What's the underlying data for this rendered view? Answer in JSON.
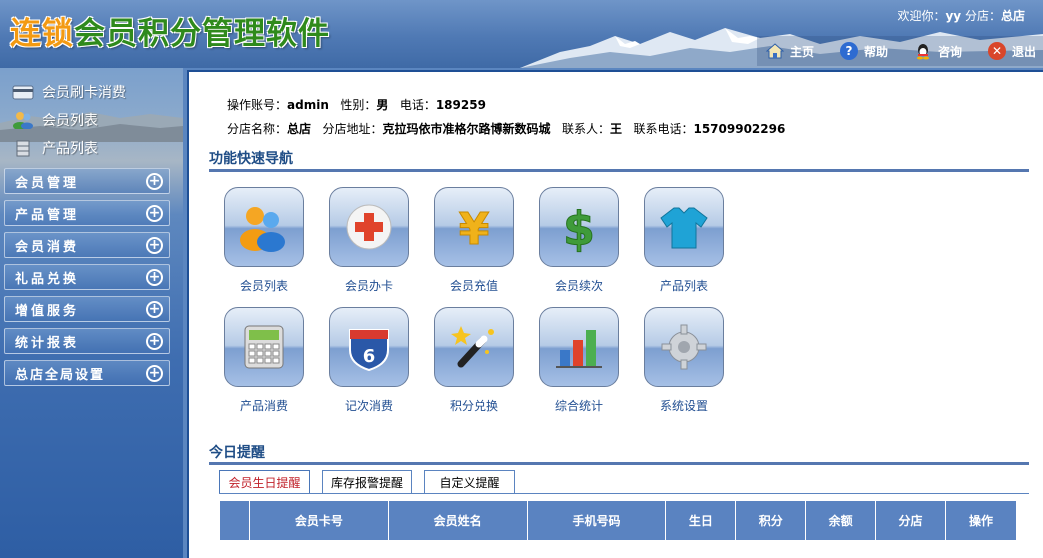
{
  "header": {
    "logo_part1": "连锁",
    "logo_part2": "会员积分管理软件",
    "welcome_prefix": "欢迎你：",
    "welcome_user": "yy",
    "branch_prefix": "分店：",
    "branch_name": "总店"
  },
  "topnav": [
    {
      "label": "主页",
      "icon": "home-icon",
      "color": "#3a6fc2"
    },
    {
      "label": "帮助",
      "icon": "help-icon",
      "color": "#2d6bd1"
    },
    {
      "label": "咨询",
      "icon": "qq-icon",
      "color": "#222222"
    },
    {
      "label": "退出",
      "icon": "exit-icon",
      "color": "#d9462b"
    }
  ],
  "quick_links": [
    {
      "label": "会员刷卡消费",
      "icon": "card-icon"
    },
    {
      "label": "会员列表",
      "icon": "users-icon"
    },
    {
      "label": "产品列表",
      "icon": "database-icon"
    }
  ],
  "menu": [
    "会员管理",
    "产品管理",
    "会员消费",
    "礼品兑换",
    "增值服务",
    "统计报表",
    "总店全局设置"
  ],
  "info": {
    "account_label": "操作账号：",
    "account": "admin",
    "gender_label": "性别：",
    "gender": "男",
    "phone_label": "电话：",
    "phone": "189259",
    "branch_label": "分店名称：",
    "branch": "总店",
    "address_label": "分店地址：",
    "address": "克拉玛依市准格尔路博新数码城",
    "contact_label": "联系人：",
    "contact": "王",
    "contact_phone_label": "联系电话：",
    "contact_phone": "15709902296"
  },
  "quick_nav": {
    "title": "功能快速导航",
    "items": [
      {
        "label": "会员列表",
        "icon": "member-list-icon"
      },
      {
        "label": "会员办卡",
        "icon": "add-card-icon"
      },
      {
        "label": "会员充值",
        "icon": "yen-icon"
      },
      {
        "label": "会员续次",
        "icon": "dollar-icon"
      },
      {
        "label": "产品列表",
        "icon": "tshirt-icon"
      },
      {
        "label": "产品消费",
        "icon": "calculator-icon"
      },
      {
        "label": "记次消费",
        "icon": "counter-icon"
      },
      {
        "label": "积分兑换",
        "icon": "magic-wand-icon"
      },
      {
        "label": "综合统计",
        "icon": "bar-chart-icon"
      },
      {
        "label": "系统设置",
        "icon": "gear-icon"
      }
    ]
  },
  "today": {
    "title": "今日提醒",
    "tabs": [
      "会员生日提醒",
      "库存报警提醒",
      "自定义提醒"
    ],
    "columns": [
      "会员卡号",
      "会员姓名",
      "手机号码",
      "生日",
      "积分",
      "余额",
      "分店",
      "操作"
    ]
  },
  "counter_number": "6",
  "colors": {
    "accent": "#5a83c1",
    "title": "#1f4d86",
    "link": "#224f92",
    "active_tab": "#c0212a"
  }
}
